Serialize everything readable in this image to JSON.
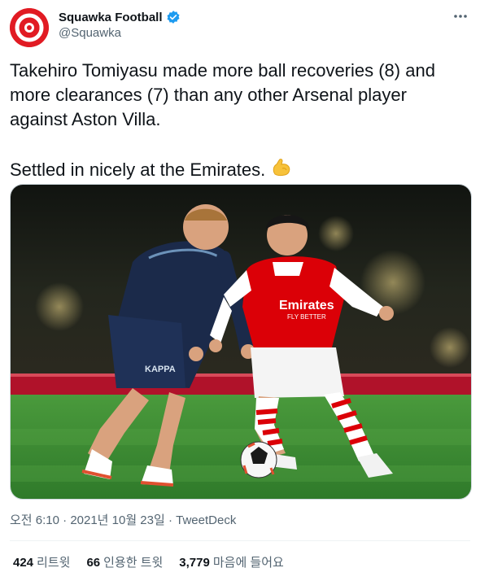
{
  "account": {
    "display_name": "Squawka Football",
    "handle": "@Squawka",
    "verified": true,
    "brand_color": "#e11b23"
  },
  "tweet": {
    "paragraph1": "Takehiro Tomiyasu made more ball recoveries (8) and more clearances (7) than any other Arsenal player against Aston Villa.",
    "paragraph2": "Settled in nicely at the Emirates.",
    "emoji": "flexed-biceps-icon"
  },
  "media": {
    "shirt_sponsor": "Emirates",
    "shirt_sponsor_sub": "FLY BETTER"
  },
  "meta": {
    "time": "오전 6:10",
    "separator": "·",
    "date": "2021년 10월 23일",
    "source": "TweetDeck"
  },
  "stats": {
    "retweets_count": "424",
    "retweets_label": "리트윗",
    "quotes_count": "66",
    "quotes_label": "인용한 트윗",
    "likes_count": "3,779",
    "likes_label": "마음에 들어요"
  },
  "colors": {
    "text": "#0f1419",
    "secondary": "#536471",
    "verified_blue": "#1d9bf0",
    "arsenal_red": "#db0007",
    "villa_navy": "#1b2a4a",
    "pitch_green": "#3f8f35"
  }
}
